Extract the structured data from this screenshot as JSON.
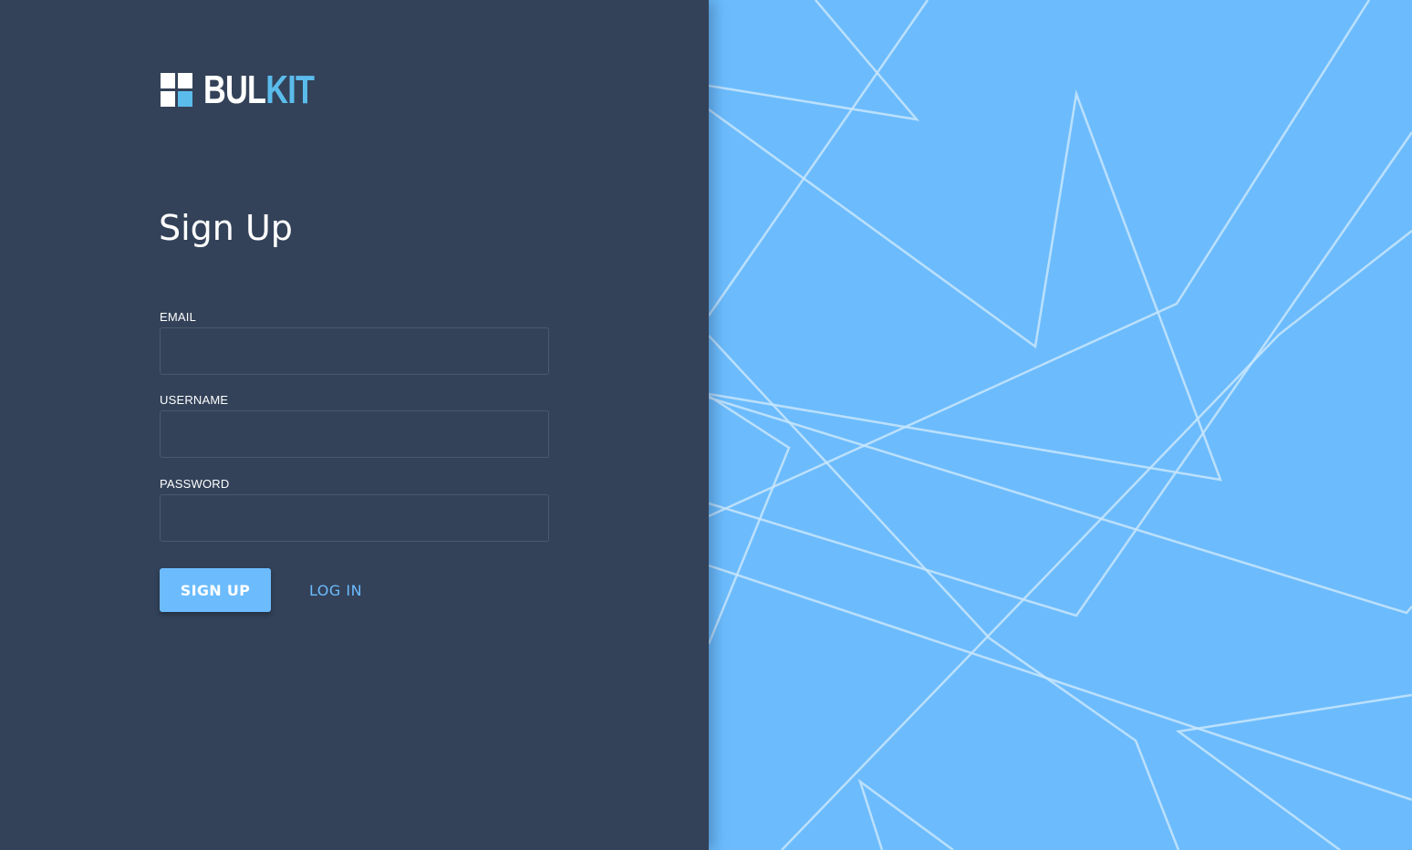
{
  "brand": {
    "name_part1": "BUL",
    "name_part2": "KIT",
    "primary_color": "#ffffff",
    "accent_color": "#5bbcec"
  },
  "form": {
    "title": "Sign Up",
    "fields": [
      {
        "label": "EMAIL",
        "value": "",
        "placeholder": ""
      },
      {
        "label": "USERNAME",
        "value": "",
        "placeholder": ""
      },
      {
        "label": "PASSWORD",
        "value": "",
        "placeholder": ""
      }
    ],
    "signup_label": "SIGN UP",
    "login_label": "LOG IN"
  },
  "theme": {
    "left_panel_bg": "#334259",
    "right_panel_bg": "#6cbcfd",
    "button_color": "#6cbcfd",
    "line_color": "#c9e6fc"
  }
}
